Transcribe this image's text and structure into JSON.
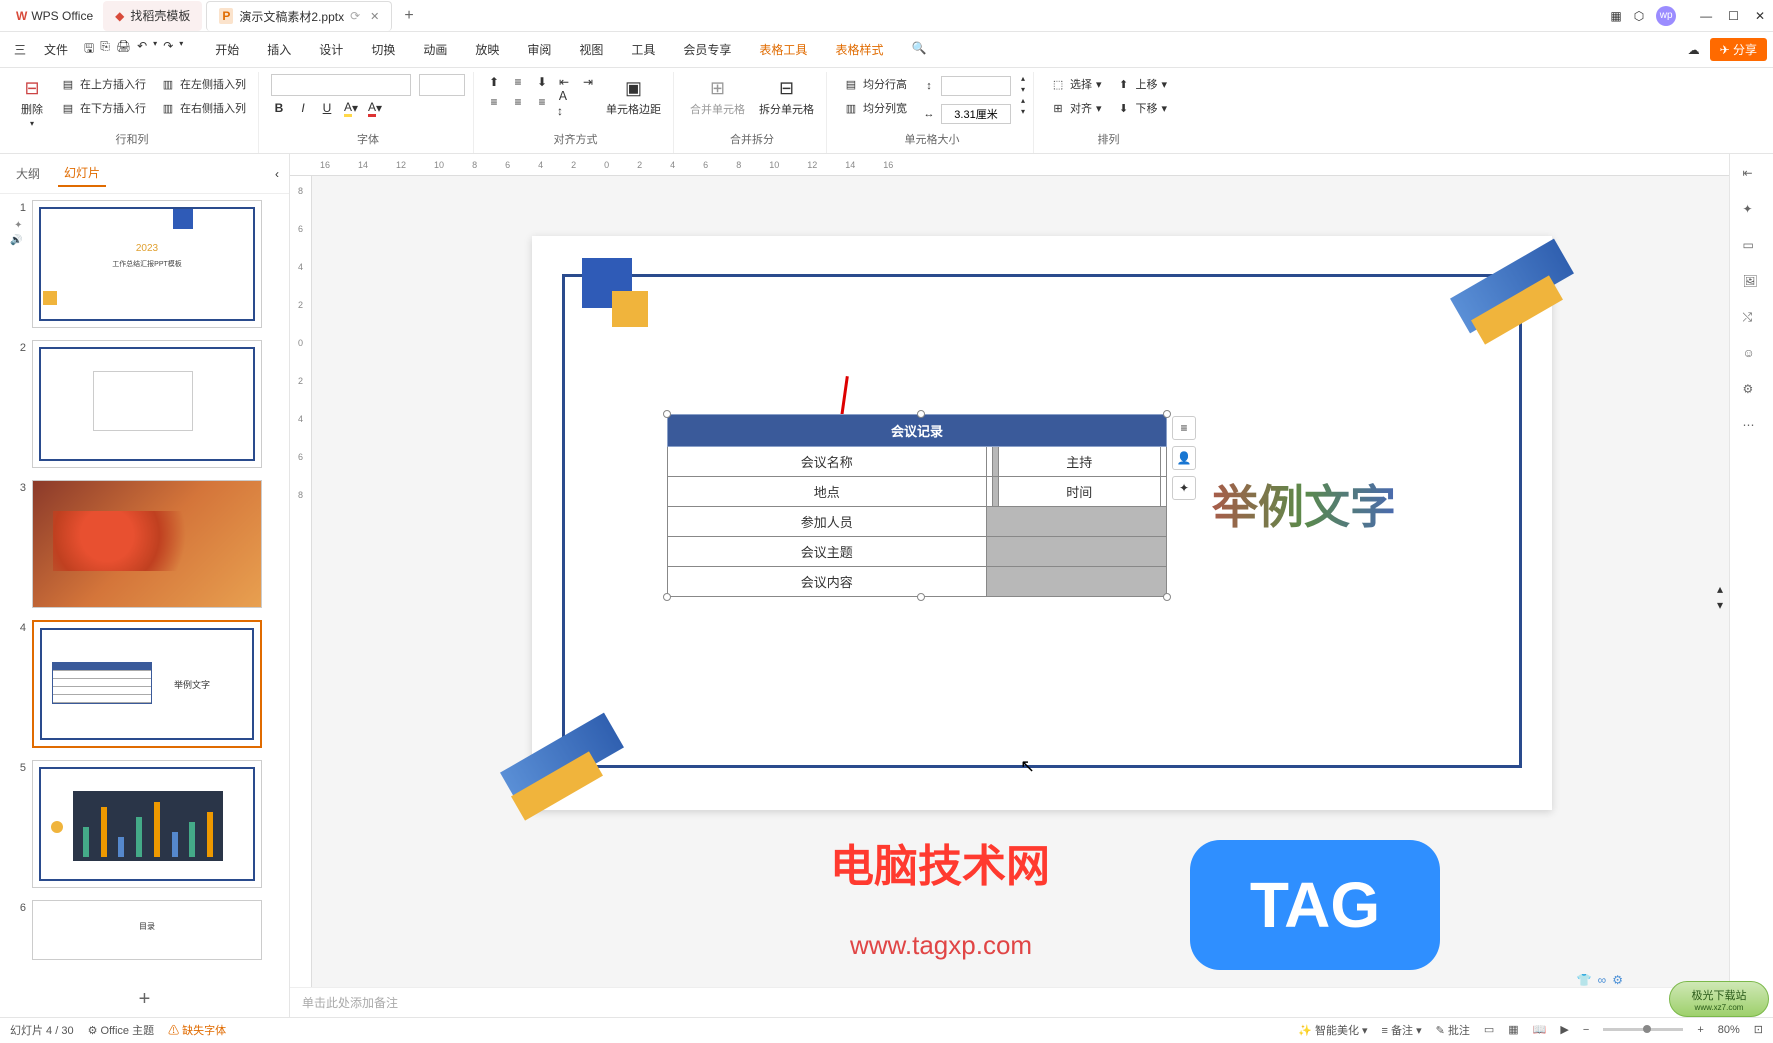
{
  "titlebar": {
    "app_name": "WPS Office",
    "tabs": [
      {
        "label": "找稻壳模板",
        "icon": "template-icon"
      },
      {
        "label": "演示文稿素材2.pptx",
        "icon": "ppt-icon",
        "active": true
      }
    ]
  },
  "menubar": {
    "file": "文件",
    "items": [
      "开始",
      "插入",
      "设计",
      "切换",
      "动画",
      "放映",
      "审阅",
      "视图",
      "工具",
      "会员专享"
    ],
    "active_items": [
      "表格工具",
      "表格样式"
    ],
    "share": "分享"
  },
  "ribbon": {
    "groups": {
      "rows_cols": {
        "label": "行和列",
        "delete": "删除",
        "insert_above": "在上方插入行",
        "insert_below": "在下方插入行",
        "insert_left": "在左侧插入列",
        "insert_right": "在右侧插入列"
      },
      "font": {
        "label": "字体"
      },
      "align": {
        "label": "对齐方式",
        "margins": "单元格边距"
      },
      "merge": {
        "label": "合并拆分",
        "merge": "合并单元格",
        "split": "拆分单元格"
      },
      "size": {
        "label": "单元格大小",
        "equal_row": "均分行高",
        "equal_col": "均分列宽",
        "width": "3.31厘米"
      },
      "arrange": {
        "label": "排列",
        "select": "选择",
        "align": "对齐",
        "up": "上移",
        "down": "下移"
      }
    }
  },
  "left_panel": {
    "tabs": {
      "outline": "大纲",
      "slides": "幻灯片"
    },
    "slide1": {
      "year": "2023",
      "title": "工作总结汇报PPT模板"
    },
    "slide4_text": "举例文字",
    "slide6_text": "目录"
  },
  "slide": {
    "table_title": "会议记录",
    "rows": [
      {
        "c1": "会议名称",
        "c3": "主持"
      },
      {
        "c1": "地点",
        "c3": "时间"
      },
      {
        "c1": "参加人员"
      },
      {
        "c1": "会议主题"
      },
      {
        "c1": "会议内容"
      }
    ],
    "gradient_text": "举例文字"
  },
  "notes": {
    "placeholder": "单击此处添加备注"
  },
  "statusbar": {
    "slide_count": "幻灯片 4 / 30",
    "theme": "Office 主题",
    "missing_font": "缺失字体",
    "beautify": "智能美化",
    "notes_btn": "备注",
    "comments": "批注",
    "zoom": "80%"
  },
  "watermark": {
    "main": "电脑技术网",
    "url": "www.tagxp.com",
    "tag": "TAG",
    "dl": "极光下载站",
    "dl_url": "www.xz7.com"
  },
  "ruler_h": [
    "16",
    "14",
    "12",
    "10",
    "8",
    "6",
    "4",
    "2",
    "0",
    "2",
    "4",
    "6",
    "8",
    "10",
    "12",
    "14",
    "16"
  ],
  "ruler_v": [
    "8",
    "6",
    "4",
    "2",
    "0",
    "2",
    "4",
    "6",
    "8"
  ],
  "menu_separator": "三"
}
